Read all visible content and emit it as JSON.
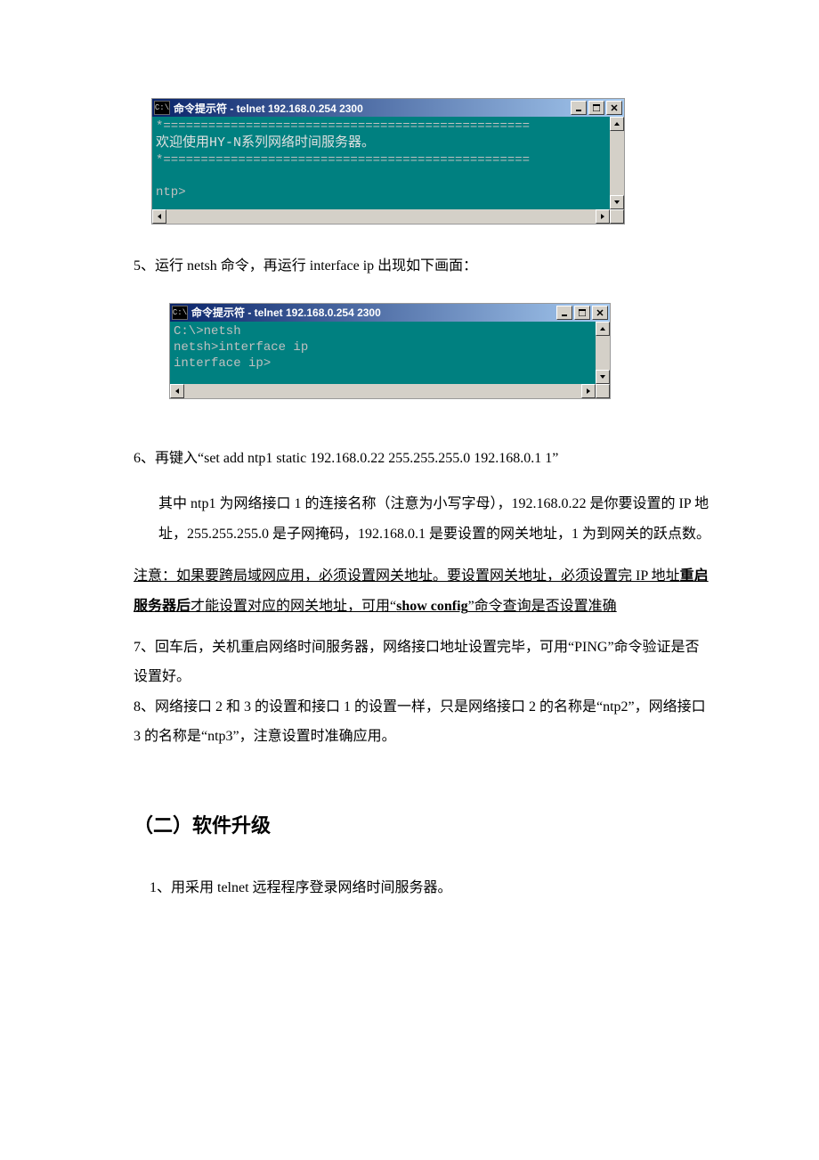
{
  "terminal1": {
    "title": "命令提示符 - telnet 192.168.0.254 2300",
    "icon_text": "C:\\",
    "line_divider_top": "*=================================================",
    "line_welcome": "欢迎使用HY-N系列网络时间服务器。",
    "line_divider_bot": "*=================================================",
    "line_prompt": "ntp>"
  },
  "para5": "5、运行 netsh 命令，再运行 interface   ip 出现如下画面：",
  "terminal2": {
    "title": "命令提示符 - telnet 192.168.0.254 2300",
    "icon_text": "C:\\",
    "line1": "C:\\>netsh",
    "line2": "netsh>interface ip",
    "line3": "interface ip>"
  },
  "para6_head": "6、再键入“set add ntp1 static 192.168.0.22   255.255.255.0   192.168.0.1   1”",
  "para6_body": "其中 ntp1 为网络接口 1 的连接名称（注意为小写字母），192.168.0.22 是你要设置的 IP 地址，255.255.255.0 是子网掩码，192.168.0.1 是要设置的网关地址，1 为到网关的跃点数。",
  "note_prefix": "注意：如果要跨局域网应用，必须设置网关地址。要设置网关地址，必须设置完 IP 地址",
  "note_bold": "重启服务器后",
  "note_mid": "才能设置对应的网关地址，可用“",
  "note_bold2": "show config",
  "note_suffix": "”命令查询是否设置准确",
  "para7": "7、回车后，关机重启网络时间服务器，网络接口地址设置完毕，可用“PING”命令验证是否设置好。",
  "para8": "8、网络接口 2 和 3 的设置和接口 1 的设置一样，只是网络接口 2 的名称是“ntp2”，网络接口 3 的名称是“ntp3”，注意设置时准确应用。",
  "section2_title": "（二）软件升级",
  "section2_p1": "1、用采用 telnet 远程程序登录网络时间服务器。"
}
